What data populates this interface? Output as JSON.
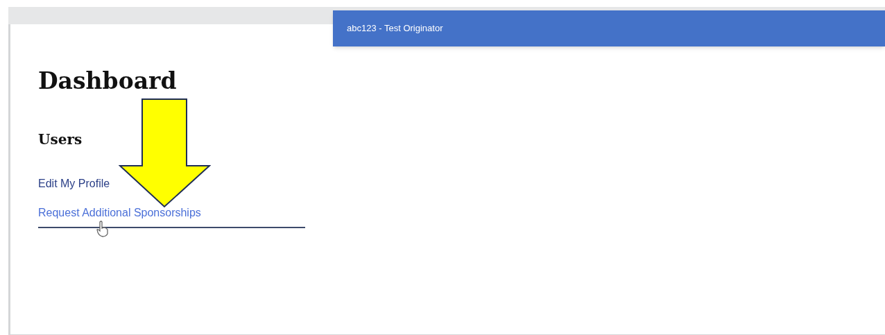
{
  "header": {
    "title": "abc123 - Test Originator"
  },
  "page": {
    "title": "Dashboard"
  },
  "section": {
    "title": "Users",
    "links": [
      {
        "label": "Edit My Profile",
        "hovered": false
      },
      {
        "label": "Request Additional Sponsorships",
        "hovered": true
      }
    ]
  }
}
